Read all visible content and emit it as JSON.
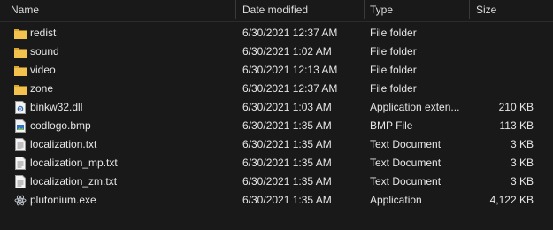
{
  "columns": {
    "name": "Name",
    "date": "Date modified",
    "type": "Type",
    "size": "Size"
  },
  "files": [
    {
      "name": "redist",
      "date": "6/30/2021 12:37 AM",
      "type": "File folder",
      "size": "",
      "icon": "folder-icon"
    },
    {
      "name": "sound",
      "date": "6/30/2021 1:02 AM",
      "type": "File folder",
      "size": "",
      "icon": "folder-icon"
    },
    {
      "name": "video",
      "date": "6/30/2021 12:13 AM",
      "type": "File folder",
      "size": "",
      "icon": "folder-icon"
    },
    {
      "name": "zone",
      "date": "6/30/2021 12:37 AM",
      "type": "File folder",
      "size": "",
      "icon": "folder-icon"
    },
    {
      "name": "binkw32.dll",
      "date": "6/30/2021 1:03 AM",
      "type": "Application exten...",
      "size": "210 KB",
      "icon": "dll-icon"
    },
    {
      "name": "codlogo.bmp",
      "date": "6/30/2021 1:35 AM",
      "type": "BMP File",
      "size": "113 KB",
      "icon": "image-file-icon"
    },
    {
      "name": "localization.txt",
      "date": "6/30/2021 1:35 AM",
      "type": "Text Document",
      "size": "3 KB",
      "icon": "text-file-icon"
    },
    {
      "name": "localization_mp.txt",
      "date": "6/30/2021 1:35 AM",
      "type": "Text Document",
      "size": "3 KB",
      "icon": "text-file-icon"
    },
    {
      "name": "localization_zm.txt",
      "date": "6/30/2021 1:35 AM",
      "type": "Text Document",
      "size": "3 KB",
      "icon": "text-file-icon"
    },
    {
      "name": "plutonium.exe",
      "date": "6/30/2021 1:35 AM",
      "type": "Application",
      "size": "4,122 KB",
      "icon": "atom-app-icon"
    }
  ],
  "colors": {
    "background": "#191919",
    "text": "#e6e6e6",
    "folder": "#f2c14e"
  }
}
